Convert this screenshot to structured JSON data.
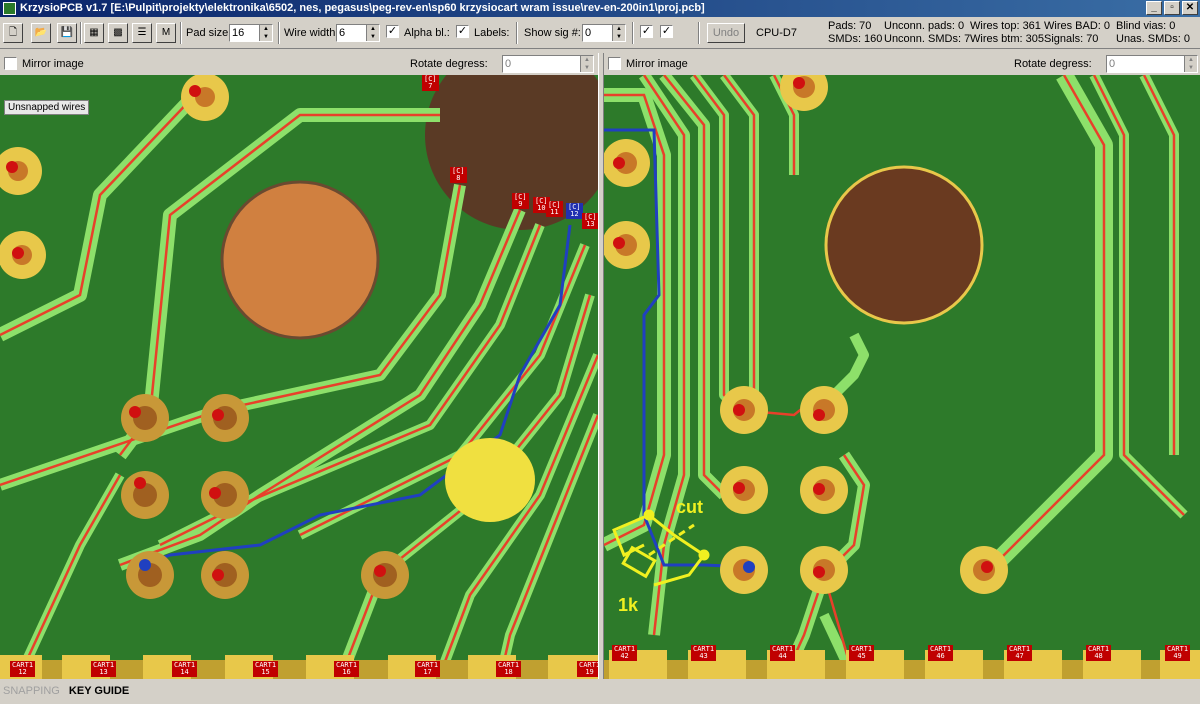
{
  "window": {
    "title": "KrzysioPCB v1.7 [E:\\Pulpit\\projekty\\elektronika\\6502, nes, pegasus\\peg-rev-en\\sp60 krzysiocart wram issue\\rev-en-200in1\\proj.pcb]",
    "minimize": "_",
    "maximize": "▫",
    "close": "✕"
  },
  "toolbar": {
    "m_label": "M",
    "pad_size_label": "Pad size:",
    "pad_size_value": "16",
    "wire_width_label": "Wire width:",
    "wire_width_value": "6",
    "alpha_label": "Alpha bl.:",
    "labels_label": "Labels:",
    "show_sig_label": "Show sig #:",
    "show_sig_value": "0",
    "undo_label": "Undo",
    "component": "CPU-D7"
  },
  "stats": {
    "pads": "Pads: 70",
    "smds": "SMDs: 160",
    "unconn_pads": "Unconn. pads: 0",
    "unconn_smds": "Unconn. SMDs: 7",
    "wires_top": "Wires top: 361",
    "wires_btm": "Wires btm: 305",
    "wires_bad": "Wires BAD: 0",
    "signals": "Signals: 70",
    "blind_vias": "Blind vias: 0",
    "unas_smds": "Unas. SMDs: 0"
  },
  "left_panel": {
    "mirror_label": "Mirror image",
    "rotate_label": "Rotate degress:",
    "rotate_value": "0",
    "unsnapped_label": "Unsnapped wires",
    "pin_labels": [
      "[C]\n7",
      "[C]\n8",
      "[C]\n9",
      "[C]\n10",
      "[C]\n11",
      "[C]\n12",
      "[C]\n13"
    ],
    "cart_labels": [
      "CART1 12",
      "CART1 13",
      "CART1 14",
      "CART1 15",
      "CART1 16",
      "CART1 17",
      "CART1 18",
      "CART1 19"
    ]
  },
  "right_panel": {
    "mirror_label": "Mirror image",
    "rotate_label": "Rotate degress:",
    "rotate_value": "0",
    "cut_label": "cut",
    "resistor_label": "1k",
    "cart_labels": [
      "CART1 42",
      "CART1 43",
      "CART1 44",
      "CART1 45",
      "CART1 46",
      "CART1 47",
      "CART1 48",
      "CART1 49"
    ]
  },
  "status": {
    "snapping": "SNAPPING",
    "key_guide": "KEY GUIDE"
  },
  "colors": {
    "board": "#2d7a2a",
    "trace_glow": "#8de06a",
    "trace_red": "#e8402a",
    "pad_gold": "#e8c84a",
    "wire_blue": "#2040c0",
    "annotation_yellow": "#f0f020"
  }
}
